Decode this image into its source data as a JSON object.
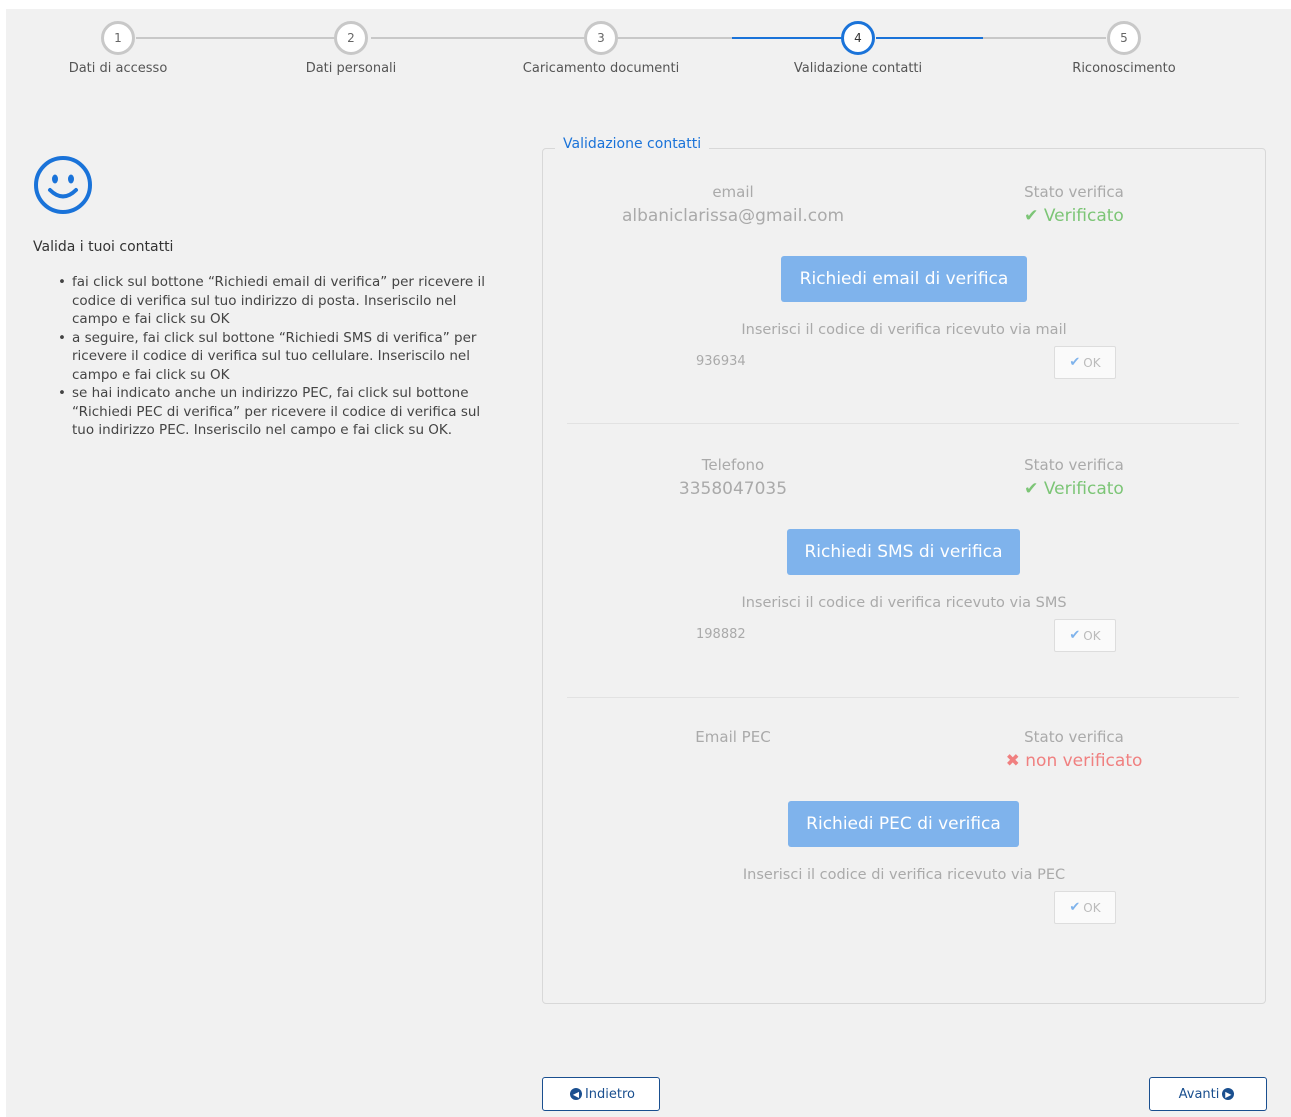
{
  "stepper": {
    "steps": [
      {
        "number": "1",
        "label": "Dati di accesso"
      },
      {
        "number": "2",
        "label": "Dati personali"
      },
      {
        "number": "3",
        "label": "Caricamento documenti"
      },
      {
        "number": "4",
        "label": "Validazione contatti"
      },
      {
        "number": "5",
        "label": "Riconoscimento"
      }
    ],
    "current_step": 4
  },
  "left": {
    "icon": "smiley-icon",
    "title": "Valida i tuoi contatti",
    "instructions": [
      "fai click sul bottone “Richiedi email di verifica” per ricevere il codice di verifica sul tuo indirizzo di posta. Inseriscilo nel campo e fai click su OK",
      "a seguire, fai click sul bottone “Richiedi SMS di verifica” per ricevere il codice di verifica sul tuo cellulare. Inseriscilo nel campo e fai click su OK",
      "se hai indicato anche un indirizzo PEC, fai click sul bottone “Richiedi PEC di verifica” per ricevere il codice di verifica sul tuo indirizzo PEC. Inseriscilo nel campo e fai click su OK."
    ]
  },
  "panel": {
    "legend": "Validazione contatti",
    "email": {
      "label": "email",
      "value": "albaniclarissa@gmail.com",
      "status_label": "Stato verifica",
      "status_icon": "check-icon",
      "status": "Verificato",
      "button": "Richiedi email di verifica",
      "hint": "Inserisci il codice di verifica ricevuto via mail",
      "code": "936934",
      "ok": "OK"
    },
    "phone": {
      "label": "Telefono",
      "value": "3358047035",
      "status_label": "Stato verifica",
      "status_icon": "check-icon",
      "status": "Verificato",
      "button": "Richiedi SMS di verifica",
      "hint": "Inserisci il codice di verifica ricevuto via SMS",
      "code": "198882",
      "ok": "OK"
    },
    "pec": {
      "label": "Email PEC",
      "value": "",
      "status_label": "Stato verifica",
      "status_icon": "cross-icon",
      "status": "non verificato",
      "button": "Richiedi PEC di verifica",
      "hint": "Inserisci il codice di verifica ricevuto via PEC",
      "code": "",
      "ok": "OK"
    }
  },
  "nav": {
    "back": "Indietro",
    "next": "Avanti"
  },
  "colors": {
    "accent": "#1a73d9",
    "button_disabled": "#7fb3ec",
    "verified": "#7cc576",
    "not_verified": "#f08080",
    "nav_border": "#1a4f8f"
  }
}
